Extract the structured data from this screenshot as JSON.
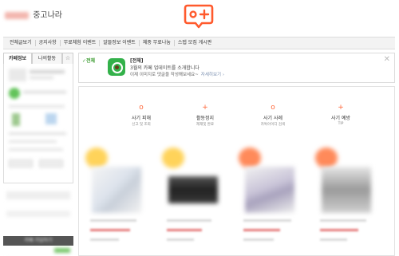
{
  "header": {
    "cafe_name": "중고나라"
  },
  "menu": {
    "items": [
      "전체글보기",
      "공지사항",
      "무료체험 이벤트",
      "알뜰정보 이벤트",
      "체중 무료나눔",
      "스텝 모집 게시판"
    ]
  },
  "sidebar": {
    "tabs": [
      "카페정보",
      "나의활동",
      "☆"
    ]
  },
  "notice": {
    "new_badge": "✓전체",
    "title": "[전체]",
    "line1": "3월의 카페 업데이트를 소개합니다",
    "line2": "이제 이미지로 댓글을 작성해보세요~",
    "link_text": "자세히보기 ›",
    "close_label": "✕"
  },
  "categories": [
    {
      "icon": "o",
      "title": "사기 피해",
      "subtitle": "신고 및 조회"
    },
    {
      "icon": "+",
      "title": "활동정지",
      "subtitle": "제재및 완료"
    },
    {
      "icon": "o",
      "title": "사기 사례",
      "subtitle": "카톡아이디 검색"
    },
    {
      "icon": "+",
      "title": "사기 예방",
      "subtitle": "TIP"
    }
  ],
  "colors": {
    "accent": "#ff6a3d",
    "notice_icon": "#33b14a"
  }
}
